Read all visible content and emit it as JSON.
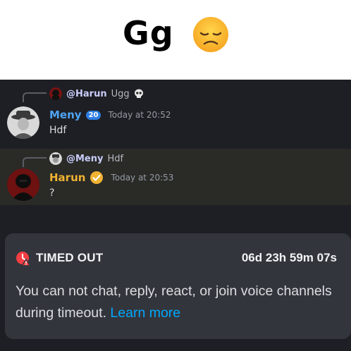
{
  "caption": {
    "text": "Gg",
    "emoji": "disappointed-face-icon"
  },
  "messages": [
    {
      "reply": {
        "user": "@Harun",
        "text": "Ugg",
        "icon": "skull-icon"
      },
      "author": "Meny",
      "author_color": "#4fa3f5",
      "badge": "20",
      "timestamp": "Today at 20:52",
      "body": "Hdf"
    },
    {
      "reply": {
        "user": "@Meny",
        "text": "Hdf"
      },
      "author": "Harun",
      "author_color": "#f0b232",
      "badge_icon": "check-badge-icon",
      "timestamp": "Today at 20:53",
      "body": "?"
    }
  ],
  "timeout": {
    "title": "TIMED OUT",
    "timer": "06d 23h 59m 07s",
    "description": "You can not chat, reply, react, or join voice channels during timeout.",
    "link": "Learn more",
    "accent": "#f23f43",
    "link_color": "#00a8fc"
  }
}
